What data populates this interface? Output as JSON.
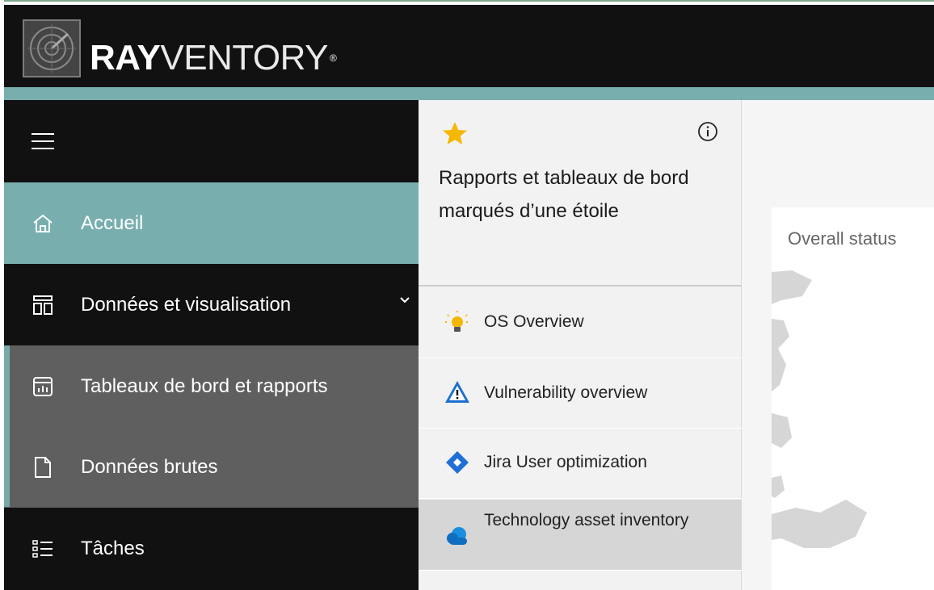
{
  "app": {
    "logo_bold": "RAY",
    "logo_light": "VENTORY",
    "logo_tm": "®"
  },
  "sidebar": {
    "menu_icon": "hamburger-icon",
    "items": [
      {
        "label": "Accueil",
        "icon": "home-icon"
      },
      {
        "label": "Données et visualisation",
        "icon": "dashboard-layout-icon"
      },
      {
        "label": "Tableaux de bord et rapports",
        "icon": "report-chart-icon"
      },
      {
        "label": "Données brutes",
        "icon": "document-icon"
      },
      {
        "label": "Tâches",
        "icon": "task-list-icon"
      }
    ]
  },
  "favorites": {
    "title": "Rapports et tableaux de bord marqués d’une étoile",
    "items": [
      {
        "label": "OS Overview",
        "icon": "lightbulb-icon"
      },
      {
        "label": "Vulnerability overview",
        "icon": "warning-triangle-icon"
      },
      {
        "label": "Jira User optimization",
        "icon": "jira-diamond-icon"
      },
      {
        "label": "Technology asset inventory",
        "icon": "cloud-icon"
      }
    ]
  },
  "main": {
    "card_title": "Overall status"
  },
  "colors": {
    "header_bg": "#111111",
    "accent_teal": "#78aeae",
    "sidebar_bg": "#101010",
    "sidebar_sub_bg": "#5f5f5f",
    "panel_bg": "#f2f2f2",
    "star": "#f5b800"
  }
}
